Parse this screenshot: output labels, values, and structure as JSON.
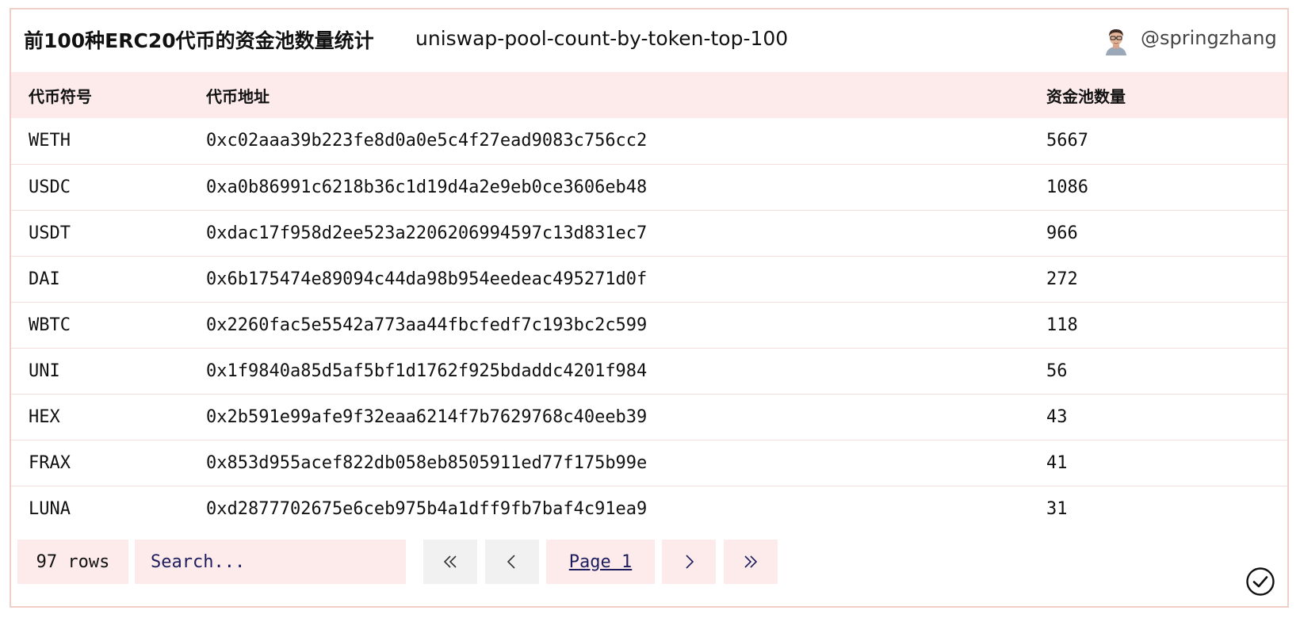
{
  "header": {
    "title": "前100种ERC20代币的资金池数量统计",
    "slug": "uniswap-pool-count-by-token-top-100",
    "author": "@springzhang"
  },
  "table": {
    "columns": [
      "代币符号",
      "代币地址",
      "资金池数量"
    ],
    "rows": [
      {
        "symbol": "WETH",
        "address": "0xc02aaa39b223fe8d0a0e5c4f27ead9083c756cc2",
        "pool_count": "5667"
      },
      {
        "symbol": "USDC",
        "address": "0xa0b86991c6218b36c1d19d4a2e9eb0ce3606eb48",
        "pool_count": "1086"
      },
      {
        "symbol": "USDT",
        "address": "0xdac17f958d2ee523a2206206994597c13d831ec7",
        "pool_count": "966"
      },
      {
        "symbol": "DAI",
        "address": "0x6b175474e89094c44da98b954eedeac495271d0f",
        "pool_count": "272"
      },
      {
        "symbol": "WBTC",
        "address": "0x2260fac5e5542a773aa44fbcfedf7c193bc2c599",
        "pool_count": "118"
      },
      {
        "symbol": "UNI",
        "address": "0x1f9840a85d5af5bf1d1762f925bdaddc4201f984",
        "pool_count": "56"
      },
      {
        "symbol": "HEX",
        "address": "0x2b591e99afe9f32eaa6214f7b7629768c40eeb39",
        "pool_count": "43"
      },
      {
        "symbol": "FRAX",
        "address": "0x853d955acef822db058eb8505911ed77f175b99e",
        "pool_count": "41"
      },
      {
        "symbol": "LUNA",
        "address": "0xd2877702675e6ceb975b4a1dff9fb7baf4c91ea9",
        "pool_count": "31"
      }
    ]
  },
  "footer": {
    "row_count": "97 rows",
    "search_placeholder": "Search...",
    "page_label": "Page 1",
    "icons": {
      "first": "double-chevron-left-icon",
      "prev": "chevron-left-icon",
      "next": "chevron-right-icon",
      "last": "double-chevron-right-icon",
      "status": "check-circle-icon"
    }
  },
  "colors": {
    "accent_bg": "#fcebea",
    "border": "#f1cfc9",
    "disabled_bg": "#f1f1f1",
    "link": "#1d1d5e"
  }
}
